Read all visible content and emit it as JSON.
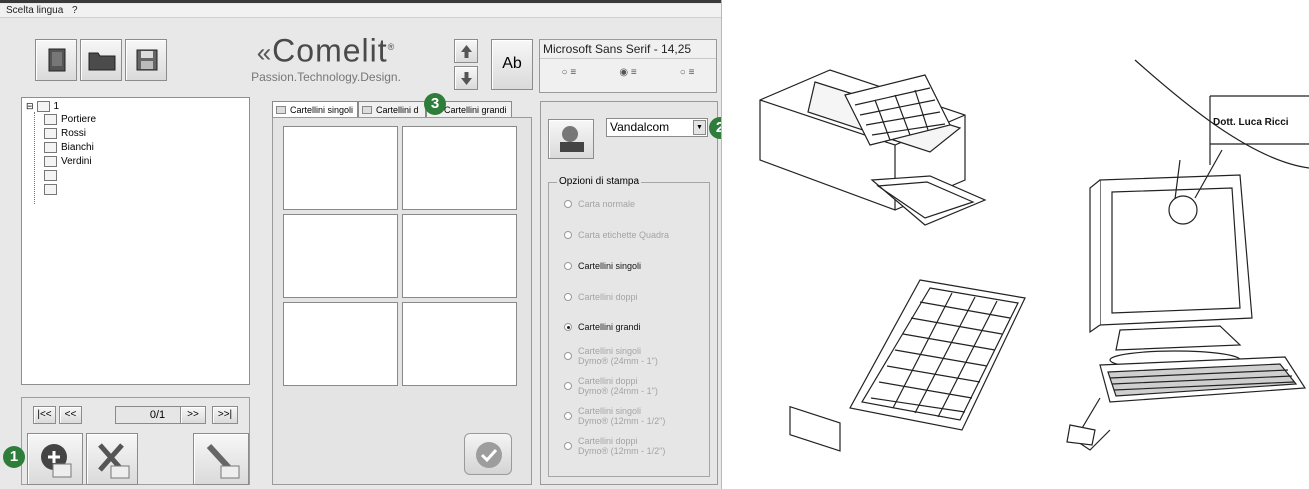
{
  "menu": {
    "items": [
      "Scelta lingua",
      "?"
    ]
  },
  "toolbar": {
    "buttons": [
      {
        "name": "new-document",
        "icon": "document-icon"
      },
      {
        "name": "open-folder",
        "icon": "folder-icon"
      },
      {
        "name": "save",
        "icon": "floppy-disk-icon"
      }
    ]
  },
  "logo": {
    "brand": "Comelit",
    "registered": "®",
    "tagline": "Passion.Technology.Design."
  },
  "font": {
    "name": "Microsoft Sans Serif - 14,25",
    "alignment_options": [
      "left",
      "center",
      "right"
    ],
    "selected_alignment": "center",
    "format_button_label": "Ab"
  },
  "tree": {
    "root": "1",
    "items": [
      "Portiere",
      "Rossi",
      "Bianchi",
      "Verdini",
      "",
      ""
    ]
  },
  "navigator": {
    "first": "|<<",
    "prev": "<<",
    "position": "0/1",
    "next": ">>",
    "last": ">>|"
  },
  "actions": {
    "add_icon": "add-entry-icon",
    "delete_icon": "delete-entry-icon",
    "edit_icon": "edit-entry-icon"
  },
  "tabs": [
    {
      "label": "Cartellini singoli",
      "active": true
    },
    {
      "label": "Cartellini d",
      "active": false
    },
    {
      "label": "Cartellini grandi",
      "active": false
    }
  ],
  "cards": {
    "count": 6
  },
  "printer": {
    "selected": "Vandalcom"
  },
  "print_options": {
    "legend": "Opzioni di stampa",
    "items": [
      {
        "label": "Carta normale",
        "enabled": false,
        "selected": false
      },
      {
        "label": "Carta etichette Quadra",
        "enabled": false,
        "selected": false
      },
      {
        "label": "Cartellini singoli",
        "enabled": true,
        "selected": false
      },
      {
        "label": "Cartellini doppi",
        "enabled": false,
        "selected": false
      },
      {
        "label": "Cartellini grandi",
        "enabled": true,
        "selected": true
      },
      {
        "label": "Cartellini singoli",
        "label2": "Dymo® (24mm - 1\")",
        "enabled": false,
        "selected": false
      },
      {
        "label": "Cartellini doppi",
        "label2": "Dymo® (24mm - 1\")",
        "enabled": false,
        "selected": false
      },
      {
        "label": "Cartellini singoli",
        "label2": "Dymo® (12mm - 1/2\")",
        "enabled": false,
        "selected": false
      },
      {
        "label": "Cartellini doppi",
        "label2": "Dymo® (12mm - 1/2\")",
        "enabled": false,
        "selected": false
      }
    ]
  },
  "badges": {
    "one": "1",
    "two": "2",
    "three": "3",
    "color": "#2e7d3a"
  },
  "illustration": {
    "callout_name": "Dott. Luca Ricci"
  }
}
